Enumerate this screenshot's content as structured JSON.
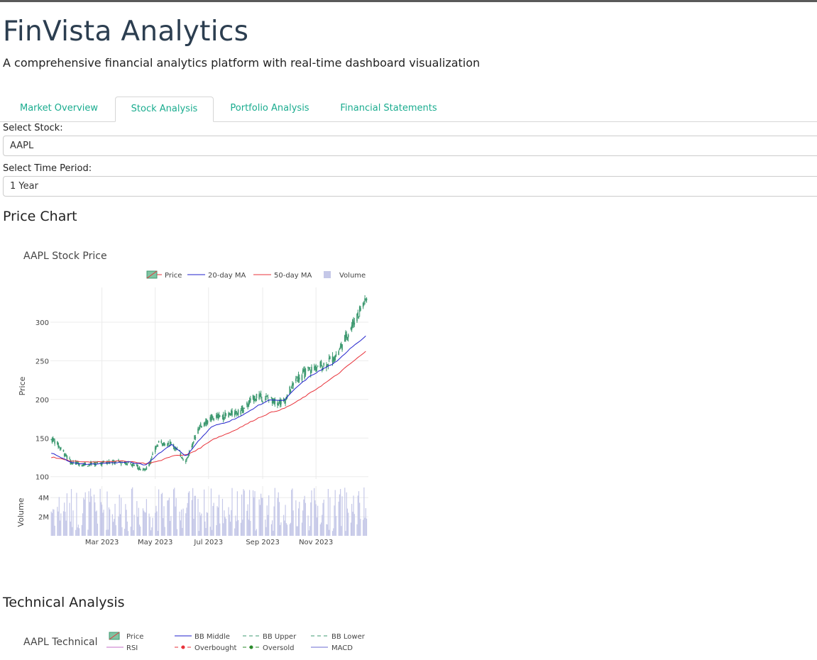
{
  "header": {
    "title": "FinVista Analytics",
    "subtitle": "A comprehensive financial analytics platform with real-time dashboard visualization"
  },
  "tabs": [
    {
      "label": "Market Overview",
      "active": false
    },
    {
      "label": "Stock Analysis",
      "active": true
    },
    {
      "label": "Portfolio Analysis",
      "active": false
    },
    {
      "label": "Financial Statements",
      "active": false
    }
  ],
  "controls": {
    "stock_label": "Select Stock:",
    "stock_value": "AAPL",
    "period_label": "Select Time Period:",
    "period_value": "1 Year"
  },
  "sections": {
    "price_chart": "Price Chart",
    "technical_analysis": "Technical Analysis"
  },
  "colors": {
    "tab_text": "#1aac8f",
    "candle_up": "#3d9970",
    "ma20": "#2222cc",
    "ma50": "#e8333b",
    "volume": "#c5c8e8"
  },
  "chart_data": [
    {
      "type": "line",
      "title": "AAPL Stock Price",
      "ylabel": "Price",
      "ylabel2": "Volume",
      "legend": [
        "Price",
        "20-day MA",
        "50-day MA",
        "Volume"
      ],
      "legend_position": "top",
      "x_ticks": [
        "Mar 2023",
        "May 2023",
        "Jul 2023",
        "Sep 2023",
        "Nov 2023"
      ],
      "y_ticks": [
        100,
        150,
        200,
        250,
        300
      ],
      "ylim": [
        97,
        345
      ],
      "volume_ticks": [
        "2M",
        "4M"
      ],
      "grid": true,
      "x": [
        "2023-01-05",
        "2023-01-25",
        "2023-02-15",
        "2023-03-10",
        "2023-04-01",
        "2023-04-20",
        "2023-05-05",
        "2023-05-20",
        "2023-06-05",
        "2023-06-20",
        "2023-07-05",
        "2023-07-25",
        "2023-08-10",
        "2023-08-25",
        "2023-09-10",
        "2023-09-25",
        "2023-10-10",
        "2023-10-25",
        "2023-11-10",
        "2023-11-25",
        "2023-12-10",
        "2023-12-28"
      ],
      "series": [
        {
          "name": "Price",
          "values": [
            148,
            118,
            116,
            119,
            118,
            108,
            145,
            143,
            120,
            165,
            176,
            180,
            188,
            205,
            200,
            196,
            228,
            238,
            245,
            258,
            292,
            330
          ]
        },
        {
          "name": "20-day MA",
          "values": [
            130,
            118,
            116,
            118,
            119,
            115,
            130,
            142,
            126,
            147,
            165,
            172,
            180,
            191,
            200,
            198,
            216,
            230,
            240,
            249,
            266,
            282
          ]
        },
        {
          "name": "50-day MA",
          "values": [
            125,
            120,
            119,
            120,
            120,
            117,
            120,
            127,
            128,
            136,
            148,
            157,
            166,
            175,
            183,
            188,
            197,
            208,
            220,
            232,
            246,
            262
          ]
        }
      ]
    },
    {
      "type": "line",
      "title": "AAPL Technical Analysis",
      "legend": [
        "Price",
        "BB Middle",
        "BB Upper",
        "BB Lower",
        "RSI",
        "Overbought",
        "Oversold",
        "MACD"
      ],
      "legend_position": "top"
    }
  ]
}
